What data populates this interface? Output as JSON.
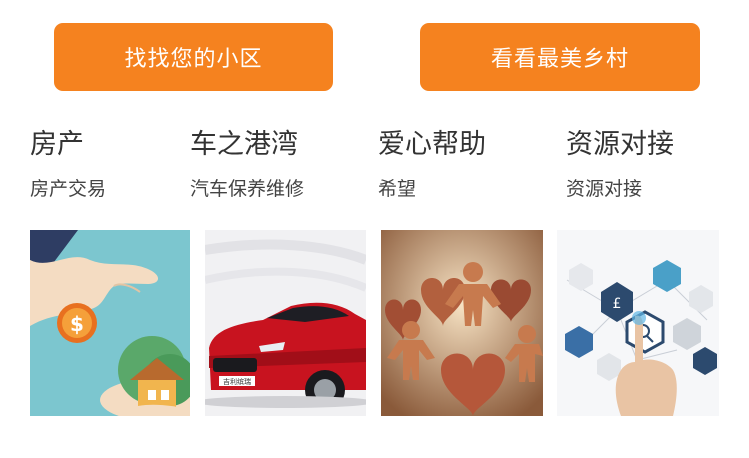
{
  "buttons": {
    "find_community": "找找您的小区",
    "beautiful_village": "看看最美乡村"
  },
  "categories": [
    {
      "title": "房产",
      "subtitle": "房产交易",
      "image_icon": "hand-coin-house"
    },
    {
      "title": "车之港湾",
      "subtitle": "汽车保养维修",
      "image_icon": "red-car"
    },
    {
      "title": "爱心帮助",
      "subtitle": "希望",
      "image_icon": "paper-people-hearts"
    },
    {
      "title": "资源对接",
      "subtitle": "资源对接",
      "image_icon": "hexagon-network-touch"
    }
  ],
  "colors": {
    "accent": "#f5821f",
    "text_primary": "#333333"
  },
  "car_plate": "吉利缤瑞"
}
